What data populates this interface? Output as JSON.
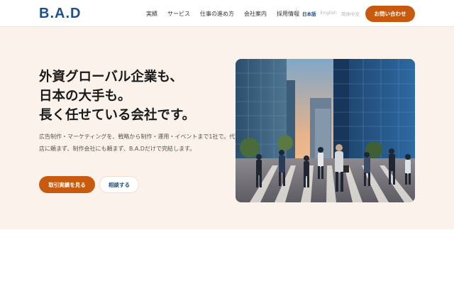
{
  "header": {
    "logo": "B.A.D",
    "nav": [
      "実績",
      "サービス",
      "仕事の進め方",
      "会社案内",
      "採用情報"
    ],
    "languages": [
      "日本語",
      "English",
      "简体中文"
    ],
    "active_language": "日本語",
    "contact_label": "お問い合わせ"
  },
  "hero": {
    "headline_lines": [
      "外資グローバル企業も、",
      "日本の大手も。",
      "長く任せている会社です。"
    ],
    "description": "広告制作・マーケティングを、戦略から制作・運用・イベントまで1社で。代理店に頼まず、制作会社にも頼まず、B.A.Dだけで完結します。",
    "primary_button": "取引実績を見る",
    "secondary_button": "相談する"
  },
  "colors": {
    "brand_blue": "#1e4e8c",
    "accent_orange": "#c85a0f",
    "hero_bg": "#fbf2eb"
  }
}
